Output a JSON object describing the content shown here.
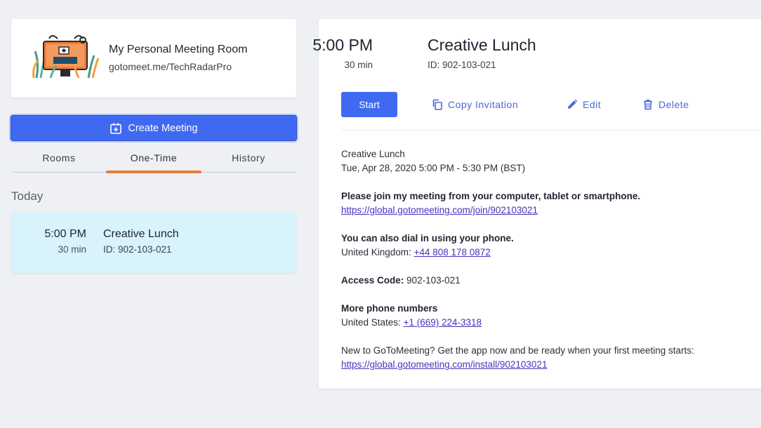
{
  "personal_room": {
    "title": "My Personal Meeting Room",
    "url": "gotomeet.me/TechRadarPro"
  },
  "create_meeting": {
    "label": "Create Meeting"
  },
  "tabs": [
    {
      "label": "Rooms",
      "active": false
    },
    {
      "label": "One-Time",
      "active": true
    },
    {
      "label": "History",
      "active": false
    }
  ],
  "list": {
    "section_label": "Today",
    "items": [
      {
        "time": "5:00 PM",
        "duration": "30 min",
        "title": "Creative Lunch",
        "id": "ID: 902-103-021"
      }
    ]
  },
  "detail": {
    "time": "5:00 PM",
    "duration": "30 min",
    "title": "Creative Lunch",
    "id": "ID: 902-103-021",
    "actions": {
      "start": "Start",
      "copy": "Copy Invitation",
      "edit": "Edit",
      "delete": "Delete"
    },
    "invitation": {
      "name": "Creative Lunch",
      "datetime": "Tue, Apr 28, 2020 5:00 PM - 5:30 PM (BST)",
      "join_heading": "Please join my meeting from your computer, tablet or smartphone.",
      "join_link": "https://global.gotomeeting.com/join/902103021",
      "dial_heading": "You can also dial in using your phone.",
      "dial_uk_label": "United Kingdom: ",
      "dial_uk_number": "+44 808 178 0872",
      "access_label": "Access Code:",
      "access_code": " 902-103-021",
      "more_heading": "More phone numbers",
      "us_label": "United States: ",
      "us_number": "+1 (669) 224-3318",
      "app_text": "New to GoToMeeting? Get the app now and be ready when your first meeting starts:",
      "app_link": "https://global.gotomeeting.com/install/902103021"
    }
  },
  "colors": {
    "primary": "#4069f2",
    "tab_indicator": "#e57c3b",
    "selected_item_bg": "#d9f3fc",
    "action_text": "#4a67d6",
    "link": "#4b2fbf",
    "background": "#eef0f4"
  },
  "icons": {
    "room": "meeting-room-illustration",
    "create": "calendar-plus-icon",
    "copy": "copy-icon",
    "edit": "pencil-icon",
    "delete": "trash-icon"
  }
}
